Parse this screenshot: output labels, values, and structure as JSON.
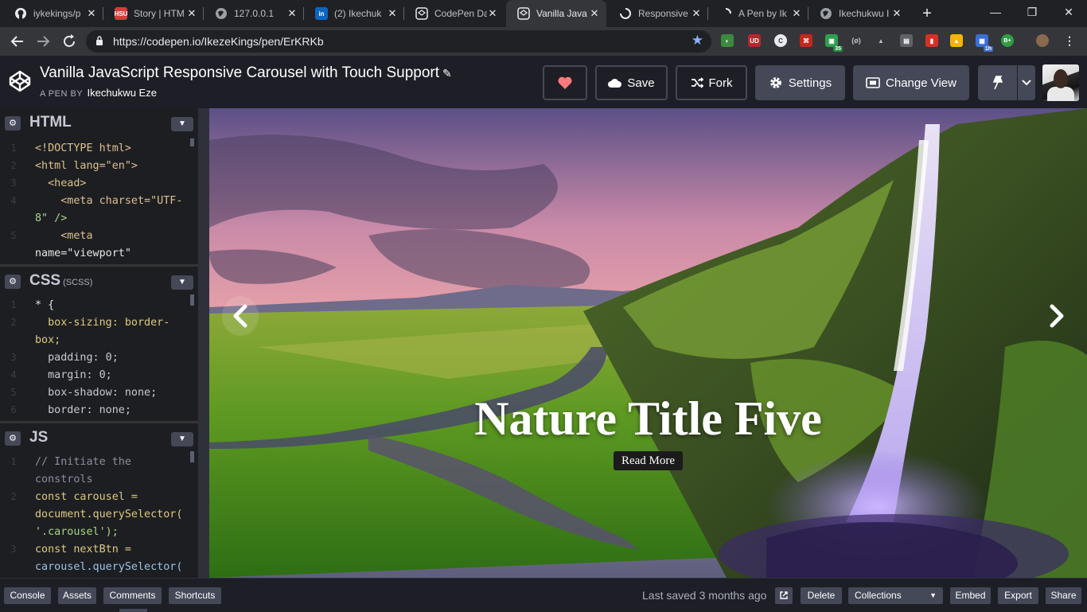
{
  "browser": {
    "tabs": [
      {
        "title": "iykekings/p",
        "icon": "github-icon",
        "active": false
      },
      {
        "title": "Story | HTM",
        "icon": "story-icon",
        "icon_text": "HSU",
        "icon_color": "#d83a3a",
        "active": false
      },
      {
        "title": "127.0.0.1",
        "icon": "globe-icon",
        "active": false
      },
      {
        "title": "(2) Ikechuk",
        "icon": "linkedin-icon",
        "icon_text": "in",
        "icon_color": "#0a66c2",
        "active": false
      },
      {
        "title": "CodePen Da",
        "icon": "codepen-icon",
        "active": false
      },
      {
        "title": "Vanilla Java",
        "icon": "codepen-icon",
        "active": true
      },
      {
        "title": "Responsive",
        "icon": "loading-icon",
        "active": false
      },
      {
        "title": "A Pen by Ik",
        "icon": "loading-icon",
        "active": false
      },
      {
        "title": "Ikechukwu I",
        "icon": "globe-icon",
        "active": false
      }
    ],
    "new_tab": "+",
    "window_controls": {
      "minimize": "—",
      "restore": "❐",
      "close": "✕"
    },
    "address_bar": {
      "url": "https://codepen.io/IkezeKings/pen/ErKRKb"
    },
    "extension_badges": {
      "green": "35",
      "calendar": "1h",
      "plus": "B+"
    }
  },
  "header": {
    "title": "Vanilla JavaScript Responsive Carousel with Touch Support",
    "by_label": "A PEN BY",
    "author": "Ikechukwu Eze",
    "buttons": {
      "save": "Save",
      "fork": "Fork",
      "settings": "Settings",
      "change_view": "Change View"
    },
    "colors": {
      "heart": "#ff7a7a",
      "header_bg": "#1e1f26",
      "button_bg": "#444857"
    }
  },
  "editors": {
    "html": {
      "name": "HTML",
      "lines": [
        {
          "num": "1",
          "code": "<!DOCTYPE html>"
        },
        {
          "num": "2",
          "code": "<html lang=\"en\">"
        },
        {
          "num": "3",
          "code": "  <head>"
        },
        {
          "num": "4",
          "code": "    <meta charset=\"UTF-"
        },
        {
          "num": "",
          "code": "8\" />"
        },
        {
          "num": "5",
          "code": "    <meta"
        },
        {
          "num": "",
          "code": "name=\"viewport\""
        }
      ]
    },
    "css": {
      "name": "CSS",
      "sub": "(SCSS)",
      "lines": [
        {
          "num": "1",
          "code": "* {"
        },
        {
          "num": "2",
          "code": "  box-sizing: border-"
        },
        {
          "num": "",
          "code": "box;"
        },
        {
          "num": "3",
          "code": "  padding: 0;"
        },
        {
          "num": "4",
          "code": "  margin: 0;"
        },
        {
          "num": "5",
          "code": "  box-shadow: none;"
        },
        {
          "num": "6",
          "code": "  border: none;"
        }
      ]
    },
    "js": {
      "name": "JS",
      "lines": [
        {
          "num": "1",
          "code": "// Initiate the"
        },
        {
          "num": "",
          "code": "constrols"
        },
        {
          "num": "2",
          "code": "const carousel ="
        },
        {
          "num": "",
          "code": "document.querySelector("
        },
        {
          "num": "",
          "code": "'.carousel');"
        },
        {
          "num": "3",
          "code": "const nextBtn ="
        },
        {
          "num": "",
          "code": "carousel.querySelector("
        }
      ]
    }
  },
  "preview": {
    "slide_title": "Nature Title Five",
    "read_more": "Read More",
    "prev_arrow": "‹",
    "next_arrow": "›"
  },
  "footer": {
    "console": "Console",
    "assets": "Assets",
    "comments": "Comments",
    "shortcuts": "Shortcuts",
    "last_saved": "Last saved 3 months ago",
    "delete": "Delete",
    "collections": "Collections",
    "embed": "Embed",
    "export": "Export",
    "share": "Share"
  }
}
